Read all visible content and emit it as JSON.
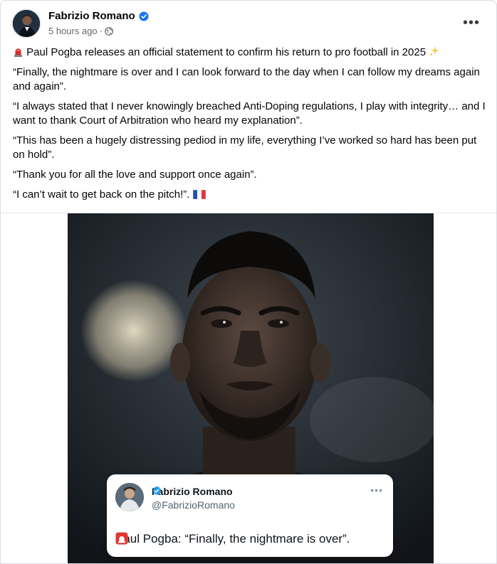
{
  "post": {
    "author": "Fabrizio Romano",
    "time": "5 hours ago",
    "meta_separator": "·",
    "more_label": "•••",
    "icons": {
      "verified": "verified-badge-icon",
      "audience": "globe-icon",
      "more": "more-options-icon",
      "siren": "siren-emoji",
      "sparkles": "sparkles-emoji",
      "flag": "france-flag-emoji"
    },
    "paragraphs": [
      " Paul Pogba releases an official statement to confirm his return to pro football in 2025 ",
      "“Finally, the nightmare is over and I can look forward to the day when I can follow my dreams again and again”.",
      "“I always stated that I never knowingly breached Anti-Doping regulations, I play with integrity… and I want to thank Court of Arbitration who heard my explanation”.",
      "“This has been a hugely distressing pediod in my life, everything I’ve worked so hard has been put on hold”.",
      "“Thank you for all the love and support once again”.",
      "“I can’t wait to get back on the pitch!”. "
    ]
  },
  "embedded_tweet": {
    "name": "Fabrizio Romano",
    "handle": "@FabrizioRomano",
    "more_label": "•••",
    "text": "Paul Pogba: “Finally, the nightmare is over”."
  },
  "colors": {
    "verified_blue": "#1d9bf0",
    "text": "#050505",
    "secondary_text": "#65676b",
    "siren_red": "#e0352f"
  }
}
